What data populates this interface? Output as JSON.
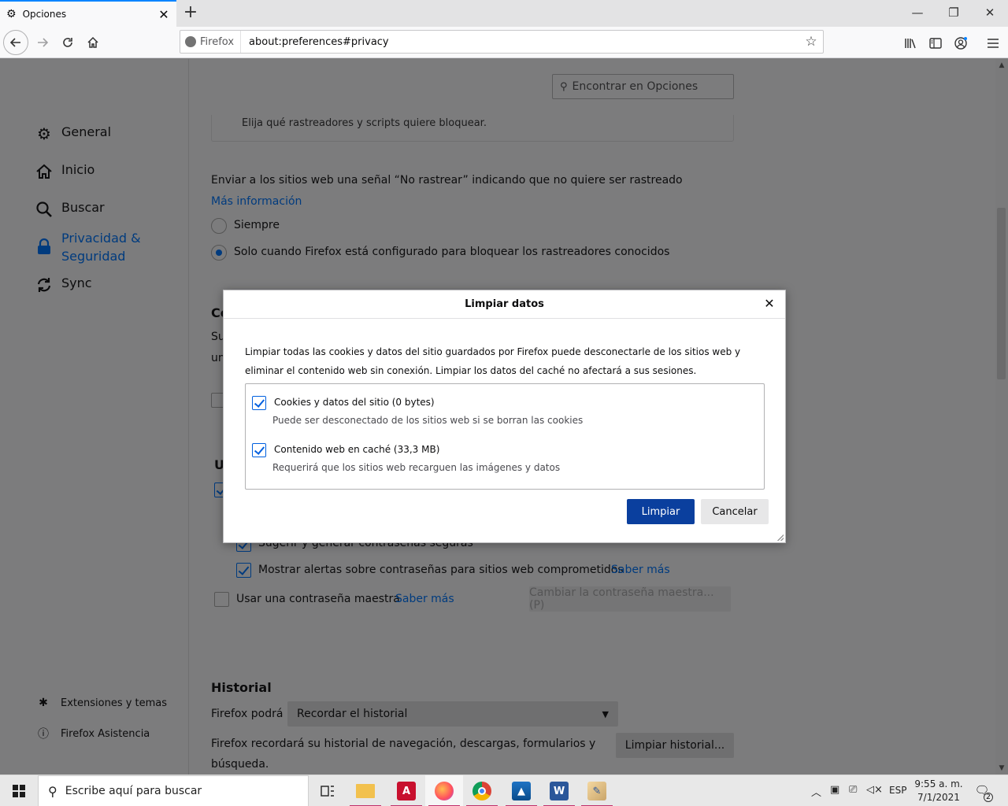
{
  "browser": {
    "tab_title": "Opciones",
    "tab_close": "✕",
    "new_tab": "+",
    "window_controls": {
      "minimize": "—",
      "restore": "❐",
      "close": "✕"
    },
    "identity_label": "Firefox",
    "url": "about:preferences#privacy",
    "icons": [
      "back-icon",
      "forward-icon",
      "reload-icon",
      "home-icon",
      "bookmark-star-icon",
      "library-icon",
      "sidebar-icon",
      "account-icon",
      "menu-icon"
    ]
  },
  "sidebar": {
    "categories": [
      {
        "label": "General",
        "icon": "gear-icon"
      },
      {
        "label": "Inicio",
        "icon": "home-icon"
      },
      {
        "label": "Buscar",
        "icon": "search-icon"
      },
      {
        "label": "Privacidad & Seguridad",
        "label_line1": "Privacidad &",
        "label_line2": "Seguridad",
        "icon": "lock-icon",
        "selected": true
      },
      {
        "label": "Sync",
        "icon": "sync-icon"
      }
    ],
    "footer": [
      {
        "label": "Extensiones y temas",
        "icon": "puzzle-icon"
      },
      {
        "label": "Firefox Asistencia",
        "icon": "help-icon"
      }
    ]
  },
  "content": {
    "find_placeholder": "Encontrar en Opciones",
    "tracker_box_text": "Elija qué rastreadores y scripts quiere bloquear.",
    "dnt_text": "Enviar a los sitios web una señal “No rastrear” indicando que no quiere ser rastreado",
    "dnt_link": "Más información",
    "dnt_options": [
      "Siempre",
      "Solo cuando Firefox está configurado para bloquear los rastreadores conocidos"
    ],
    "dnt_selected": 1,
    "partial_cookies_heading": "Co",
    "partial_line1": "Su",
    "partial_line2": "un",
    "partial_logins_heading": "U",
    "suggest_passwords": "Sugerir y generar contraseñas seguras",
    "breach_alerts": "Mostrar alertas sobre contraseñas para sitios web comprometidos",
    "breach_alerts_link": "Saber más",
    "master_password": "Usar una contraseña maestra",
    "master_password_link": "Saber más",
    "change_master_button": "Cambiar la contraseña maestra... (P)",
    "history_heading": "Historial",
    "history_will": "Firefox podrá",
    "history_select_value": "Recordar el historial",
    "history_desc_line1": "Firefox recordará su historial de navegación, descargas, formularios y",
    "history_desc_line2": "búsqueda.",
    "clear_history_button": "Limpiar historial..."
  },
  "dialog": {
    "title": "Limpiar datos",
    "close": "✕",
    "description_line1": "Limpiar todas las cookies y datos del sitio guardados por Firefox puede desconectarle de los sitios web y",
    "description_line2": "eliminar el contenido web sin conexión. Limpiar los datos del caché no afectará a sus sesiones.",
    "options": [
      {
        "label": "Cookies y datos del sitio (0 bytes)",
        "description": "Puede ser desconectado de los sitios web si se borran las cookies",
        "checked": true
      },
      {
        "label": "Contenido web en caché (33,3 MB)",
        "description": "Requerirá que los sitios web recarguen las imágenes y datos",
        "checked": true
      }
    ],
    "primary_button": "Limpiar",
    "cancel_button": "Cancelar"
  },
  "taskbar": {
    "search_placeholder": "Escribe aquí para buscar",
    "apps": [
      "task-view-icon",
      "file-explorer-icon",
      "acrobat-icon",
      "firefox-icon",
      "chrome-icon",
      "photos-icon",
      "word-icon",
      "paint-icon"
    ],
    "language": "ESP",
    "time": "9:55 a. m.",
    "date": "7/1/2021",
    "notification_count": "2"
  },
  "colors": {
    "accent": "#0a84ff",
    "selected_nav": "#003b7e",
    "primary_button": "#0a3f9e",
    "dim_overlay": "#7c7c7d"
  }
}
